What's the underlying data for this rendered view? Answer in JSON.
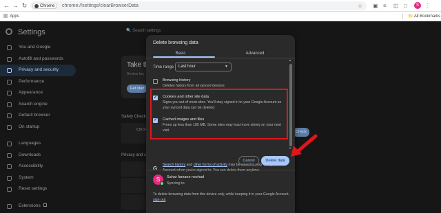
{
  "browser": {
    "chip_label": "Chrome",
    "url": "chrome://settings/clearBrowserData",
    "bookmarks_apps": "Apps",
    "bookmarks_all": "All Bookmarks",
    "profile_initial": "S"
  },
  "settings": {
    "title": "Settings",
    "search_placeholder": "Search settings",
    "nav": [
      {
        "label": "You and Google",
        "icon": "person-icon"
      },
      {
        "label": "Autofill and passwords",
        "icon": "autofill-icon"
      },
      {
        "label": "Privacy and security",
        "icon": "shield-icon"
      },
      {
        "label": "Performance",
        "icon": "speedometer-icon"
      },
      {
        "label": "Appearance",
        "icon": "palette-icon"
      },
      {
        "label": "Search engine",
        "icon": "search-icon"
      },
      {
        "label": "Default browser",
        "icon": "browser-icon"
      },
      {
        "label": "On startup",
        "icon": "power-icon"
      },
      {
        "label": "Languages",
        "icon": "globe-icon"
      },
      {
        "label": "Downloads",
        "icon": "download-icon"
      },
      {
        "label": "Accessibility",
        "icon": "accessibility-icon"
      },
      {
        "label": "System",
        "icon": "wrench-icon"
      },
      {
        "label": "Reset settings",
        "icon": "reset-icon"
      },
      {
        "label": "Extensions",
        "icon": "puzzle-icon"
      }
    ],
    "take_title": "Take the",
    "take_sub": "Review key",
    "get_started": "Get start",
    "safety_check": "Safety Check",
    "chrome_label": "Chrom",
    "check_now": "Check",
    "privacy_section": "Privacy and se"
  },
  "dialog": {
    "title": "Delete browsing data",
    "tabs": [
      "Basic",
      "Advanced"
    ],
    "time_range_label": "Time range",
    "time_range_value": "Last hour",
    "options": [
      {
        "title": "Browsing history",
        "desc": "Deletes history from all synced devices",
        "checked": false
      },
      {
        "title": "Cookies and other site data",
        "desc": "Signs you out of most sites. You'll stay signed in to your Google Account so your synced data can be deleted.",
        "checked": true
      },
      {
        "title": "Cached images and files",
        "desc": "Frees up less than 185 MB. Some sites may load more slowly on your next visit.",
        "checked": true
      }
    ],
    "google_note_link1": "Search history",
    "google_note_mid": " and ",
    "google_note_link2": "other forms of activity",
    "google_note_rest": " may be saved in your Google Account when you're signed in. You can delete them anytime.",
    "cancel": "Cancel",
    "delete": "Delete data",
    "account_name": "Sahar farzane nezhad",
    "account_status": "Syncing to",
    "footer_text": "To delete browsing data from this device only, while keeping it in your Google Account, ",
    "footer_link": "sign out",
    "footer_end": "."
  },
  "colors": {
    "accent": "#a8c7fa",
    "highlight_box": "#e3151a",
    "avatar": "#e8287d"
  }
}
